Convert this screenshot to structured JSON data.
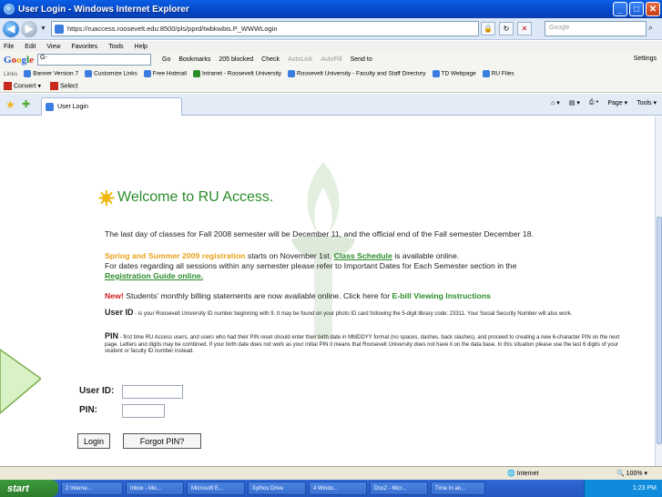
{
  "window": {
    "title": "User Login - Windows Internet Explorer"
  },
  "address": {
    "url": "https://ruaccess.roosevelt.edu:8500/pls/pprd/twbkwbis.P_WWWLogin",
    "search_placeholder": "Google"
  },
  "menu": [
    "File",
    "Edit",
    "View",
    "Favorites",
    "Tools",
    "Help"
  ],
  "google_toolbar": {
    "logo": "Google",
    "search_value": "G-",
    "items": [
      "Go",
      "Bookmarks",
      "205 blocked",
      "Check",
      "AutoLink",
      "AutoFill",
      "Send to"
    ],
    "settings": "Settings"
  },
  "links_bar": {
    "label": "Links",
    "items": [
      "Banner Version 7",
      "Customize Links",
      "Free Hotmail",
      "Intranet - Roosevelt University",
      "Roosevelt University - Faculty and Staff Directory",
      "TD Webpage",
      "RU Files"
    ]
  },
  "convert_bar": {
    "convert": "Convert",
    "select": "Select"
  },
  "tab": {
    "label": "User Login"
  },
  "command_bar": [
    "Page",
    "Tools"
  ],
  "page": {
    "welcome": "Welcome to RU Access.",
    "para1": "The last day of classes for Fall 2008 semester will be December 11, and the official end of the Fall semester December 18.",
    "para2_highlight": "Spring and Summer 2009 registration",
    "para2_mid": " starts on November 1st. ",
    "para2_link": "Class Schedule",
    "para2_end": " is available online.",
    "para3_start": "For dates regarding all sessions within any semester please refer to Important Dates for Each Semester section in the",
    "para3_link": "Registration Guide online.",
    "new_label": "New!",
    "new_text": " Students' monthly billing statements are now available online. Click here for ",
    "new_link": "E-bill Viewing Instructions",
    "userid_label_small": "User ID",
    "userid_text": " - is your Roosevelt University ID number beginning with 9. It may be found on your photo ID card following the 5-digit library code: 23311. Your Social Security Number will also work.",
    "pin_label_small": "PIN",
    "pin_text": " - first time RU Access users, and users who had their PIN reset should enter their birth date in MMDDYY format (no spaces, dashes, back slashes), and proceed to creating a new 6-character PIN on the next page. Letters and digits may be combined. If your birth date does not work as your initial PIN it means that Roosevelt University does not have it on the data base. In this situation please use the last 6 digits of your student or faculty ID number instead.",
    "form": {
      "userid_label": "User ID:",
      "pin_label": "PIN:",
      "login_button": "Login",
      "forgot_button": "Forgot PIN?"
    }
  },
  "status": {
    "zone": "Internet",
    "zoom": "100%"
  },
  "taskbar": {
    "start": "start",
    "items": [
      "2 Interne...",
      "Inbox - Mic...",
      "Microsoft E...",
      "Xythos Drive",
      "4 Windo...",
      "Doc2 - Micr...",
      "Time In an..."
    ],
    "clock": "1:23 PM"
  },
  "colors": {
    "welcome": "#2a8d2a",
    "highlight": "#e8a21a",
    "new": "#d11b1b"
  }
}
